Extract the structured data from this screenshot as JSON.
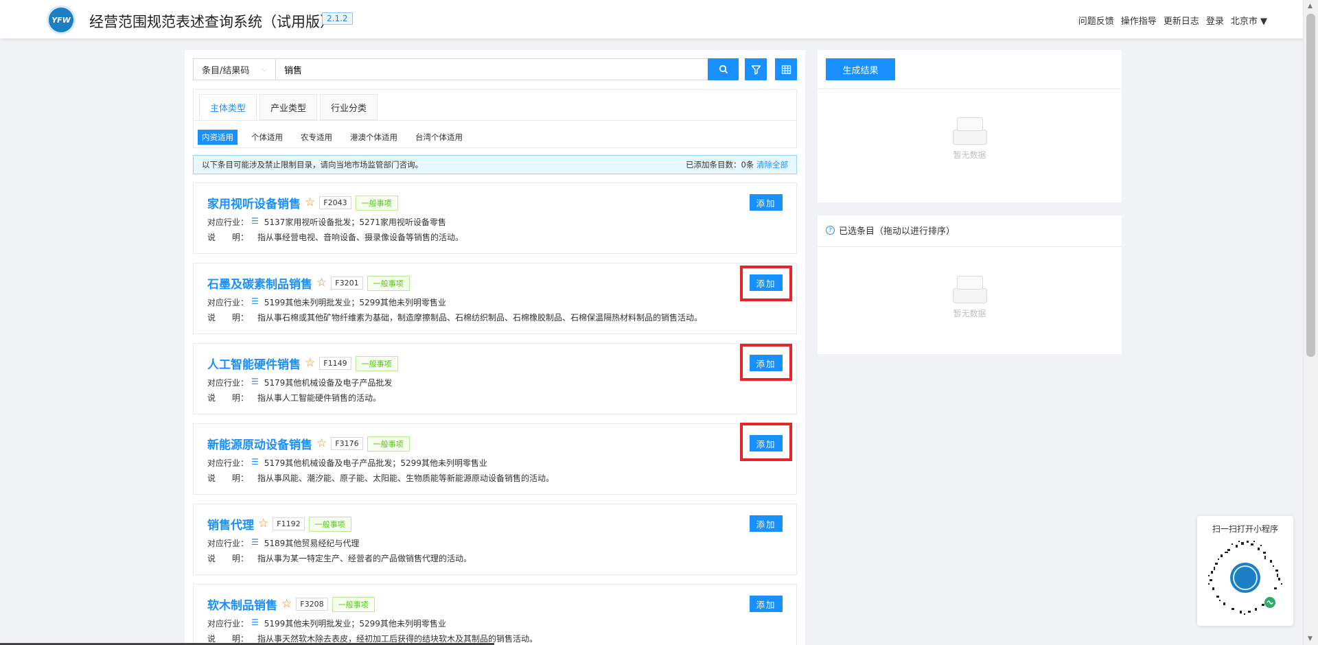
{
  "header": {
    "logo_text": "YFW",
    "title": "经营范围规范表述查询系统（试用版）",
    "version": "2.1.2",
    "nav": [
      "问题反馈",
      "操作指导",
      "更新日志",
      "登录",
      "北京市"
    ]
  },
  "search": {
    "type_label": "条目/结果码",
    "query": "销售"
  },
  "tabs": [
    "主体类型",
    "产业类型",
    "行业分类"
  ],
  "chips": [
    "内资适用",
    "个体适用",
    "农专适用",
    "港澳个体适用",
    "台湾个体适用"
  ],
  "notice": {
    "text": "以下条目可能涉及禁止限制目录，请向当地市场监管部门咨询。",
    "count_text": "已添加条目数：0条",
    "clear_label": "清除全部"
  },
  "labels": {
    "industry": "对应行业：",
    "desc": "说　　明：",
    "add": "添加"
  },
  "items": [
    {
      "title": "家用视听设备销售",
      "code": "F2043",
      "tag": "一般事项",
      "industry": "5137家用视听设备批发；5271家用视听设备零售",
      "desc": "指从事经营电视、音响设备、摄录像设备等销售的活动。"
    },
    {
      "title": "石墨及碳素制品销售",
      "code": "F3201",
      "tag": "一般事项",
      "industry": "5199其他未列明批发业；5299其他未列明零售业",
      "desc": "指从事石棉或其他矿物纤维素为基础，制造摩擦制品、石棉纺织制品、石棉橡胶制品、石棉保温隔热材料制品的销售活动。"
    },
    {
      "title": "人工智能硬件销售",
      "code": "F1149",
      "tag": "一般事项",
      "industry": "5179其他机械设备及电子产品批发",
      "desc": "指从事人工智能硬件销售的活动。"
    },
    {
      "title": "新能源原动设备销售",
      "code": "F3176",
      "tag": "一般事项",
      "industry": "5179其他机械设备及电子产品批发；5299其他未列明零售业",
      "desc": "指从事风能、潮汐能、原子能、太阳能、生物质能等新能源原动设备销售的活动。"
    },
    {
      "title": "销售代理",
      "code": "F1192",
      "tag": "一般事项",
      "industry": "5189其他贸易经纪与代理",
      "desc": "指从事为某一特定生产、经营者的产品做销售代理的活动。"
    },
    {
      "title": "软木制品销售",
      "code": "F3208",
      "tag": "一般事项",
      "industry": "5199其他未列明批发业；5299其他未列明零售业",
      "desc": "指从事天然软木除去表皮，经初加工后获得的结块软木及其制品的销售活动。"
    }
  ],
  "result_panel": {
    "generate_label": "生成结果",
    "empty_text": "暂无数据"
  },
  "selected_panel": {
    "title": "已选条目（拖动以进行排序）",
    "empty_text": "暂无数据"
  },
  "qr": {
    "title": "扫一扫打开小程序"
  },
  "colors": {
    "primary": "#1890ff",
    "highlight": "#e8242b",
    "tag_green": "#52c41a"
  }
}
